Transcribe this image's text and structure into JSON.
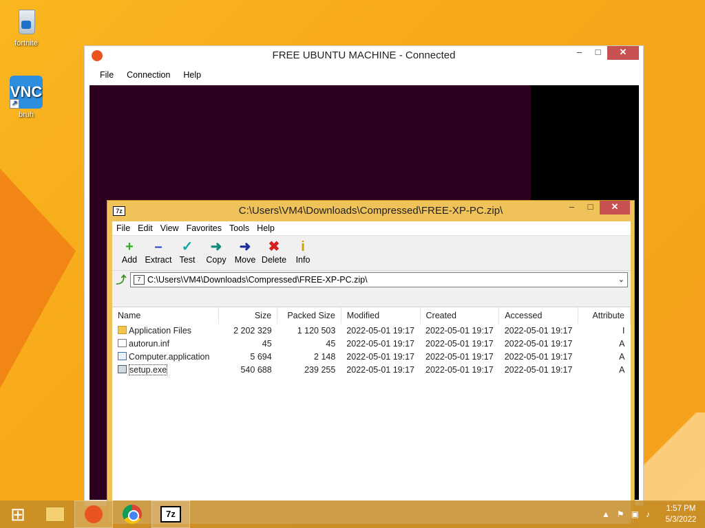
{
  "desktop": {
    "icons": [
      {
        "label": "fortnite",
        "icon": "recycle-bin-icon"
      },
      {
        "label": "bruh",
        "icon": "vnc-viewer-icon",
        "glyph": "VNC"
      }
    ]
  },
  "vnc_window": {
    "title": "FREE UBUNTU MACHINE - Connected",
    "menu": [
      "File",
      "Connection",
      "Help"
    ],
    "controls": {
      "minimize": "–",
      "maximize": "□",
      "close": "✕"
    }
  },
  "zip_window": {
    "title": "C:\\Users\\VM4\\Downloads\\Compressed\\FREE-XP-PC.zip\\",
    "logo": "7z",
    "menu": [
      "File",
      "Edit",
      "View",
      "Favorites",
      "Tools",
      "Help"
    ],
    "toolbar": [
      {
        "label": "Add",
        "icon": "add-icon",
        "glyph": "+",
        "color": "#2fae1e"
      },
      {
        "label": "Extract",
        "icon": "extract-icon",
        "glyph": "–",
        "color": "#1f3fbf"
      },
      {
        "label": "Test",
        "icon": "test-icon",
        "glyph": "✓",
        "color": "#1aa6a6"
      },
      {
        "label": "Copy",
        "icon": "copy-icon",
        "glyph": "➜",
        "color": "#148a7a"
      },
      {
        "label": "Move",
        "icon": "move-icon",
        "glyph": "➜",
        "color": "#1f2f9f"
      },
      {
        "label": "Delete",
        "icon": "delete-icon",
        "glyph": "✖",
        "color": "#d42020"
      },
      {
        "label": "Info",
        "icon": "info-icon",
        "glyph": "i",
        "color": "#c9a400"
      }
    ],
    "address": "C:\\Users\\VM4\\Downloads\\Compressed\\FREE-XP-PC.zip\\",
    "columns": [
      "Name",
      "Size",
      "Packed Size",
      "Modified",
      "Created",
      "Accessed",
      "Attribute"
    ],
    "rows": [
      {
        "name": "Application Files",
        "type": "folder",
        "size": "2 202 329",
        "packed": "1 120 503",
        "modified": "2022-05-01 19:17",
        "created": "2022-05-01 19:17",
        "accessed": "2022-05-01 19:17",
        "attr": "I"
      },
      {
        "name": "autorun.inf",
        "type": "inf",
        "size": "45",
        "packed": "45",
        "modified": "2022-05-01 19:17",
        "created": "2022-05-01 19:17",
        "accessed": "2022-05-01 19:17",
        "attr": "A"
      },
      {
        "name": "Computer.application",
        "type": "app",
        "size": "5 694",
        "packed": "2 148",
        "modified": "2022-05-01 19:17",
        "created": "2022-05-01 19:17",
        "accessed": "2022-05-01 19:17",
        "attr": "A"
      },
      {
        "name": "setup.exe",
        "type": "exe",
        "size": "540 688",
        "packed": "239 255",
        "modified": "2022-05-01 19:17",
        "created": "2022-05-01 19:17",
        "accessed": "2022-05-01 19:17",
        "attr": "A"
      }
    ]
  },
  "taskbar": {
    "items": [
      "start-button",
      "file-explorer",
      "ubuntu-vnc",
      "chrome",
      "7-zip"
    ],
    "tb_7z_label": "7z",
    "start_glyph": "⊞",
    "tray_icons": [
      "▲",
      "⚑",
      "▣",
      "♪"
    ],
    "time": "1:57 PM",
    "date": "5/3/2022"
  }
}
